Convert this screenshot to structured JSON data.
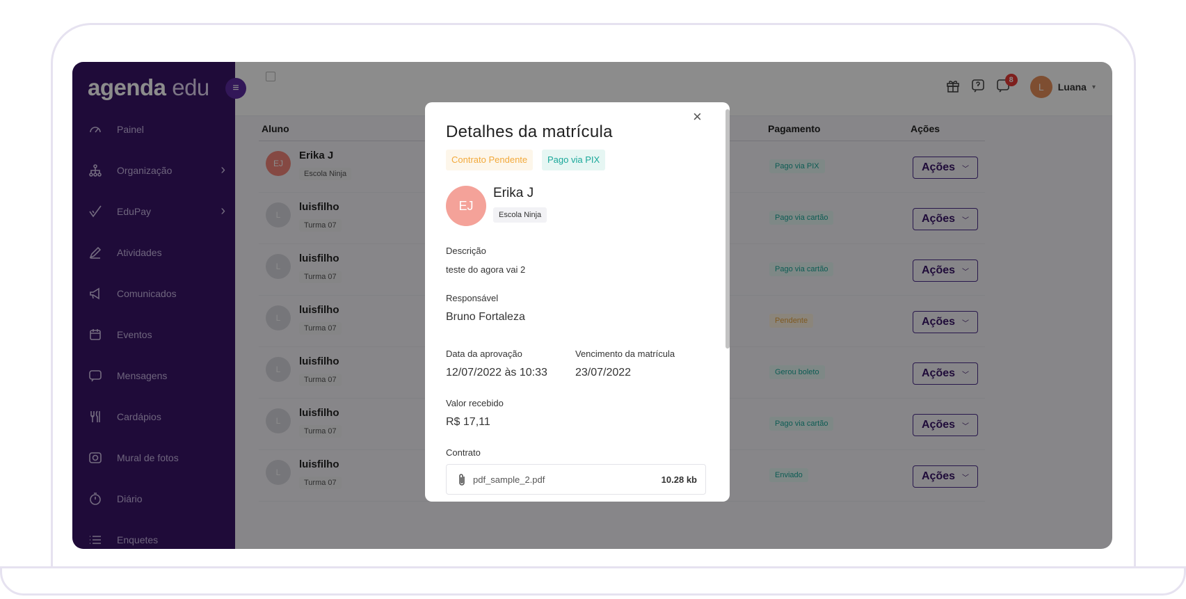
{
  "brand": {
    "logo_bold": "agenda",
    "logo_light": "edu",
    "collapse_glyph": "≡"
  },
  "sidebar": {
    "items": [
      {
        "label": "Painel",
        "icon": "gauge-icon"
      },
      {
        "label": "Organização",
        "icon": "org-chart-icon",
        "has_submenu": true
      },
      {
        "label": "EduPay",
        "icon": "edupay-check-icon",
        "has_submenu": true
      },
      {
        "label": "Atividades",
        "icon": "pencil-icon"
      },
      {
        "label": "Comunicados",
        "icon": "megaphone-icon"
      },
      {
        "label": "Eventos",
        "icon": "calendar-icon"
      },
      {
        "label": "Mensagens",
        "icon": "chat-icon"
      },
      {
        "label": "Cardápios",
        "icon": "utensils-icon"
      },
      {
        "label": "Mural de fotos",
        "icon": "camera-icon"
      },
      {
        "label": "Diário",
        "icon": "stopwatch-icon"
      },
      {
        "label": "Enquetes",
        "icon": "list-icon"
      }
    ]
  },
  "topbar": {
    "notifications_count": "8",
    "user_initial": "L",
    "user_name": "Luana",
    "caret": "▾"
  },
  "table": {
    "headers": {
      "aluno": "Aluno",
      "pagamento": "Pagamento",
      "acoes": "Ações"
    },
    "action_label": "Ações",
    "action_chevron": "﹀",
    "rows": [
      {
        "initials": "EJ",
        "name": "Erika J",
        "class": "Escola Ninja",
        "status": "Pago via PIX",
        "status_color": "green"
      },
      {
        "initials": "L",
        "name": "luisfilho",
        "class": "Turma 07",
        "status": "Pago via cartão",
        "status_color": "green"
      },
      {
        "initials": "L",
        "name": "luisfilho",
        "class": "Turma 07",
        "status": "Pago via cartão",
        "status_color": "green"
      },
      {
        "initials": "L",
        "name": "luisfilho",
        "class": "Turma 07",
        "status": "Pendente",
        "status_color": "yellow"
      },
      {
        "initials": "L",
        "name": "luisfilho",
        "class": "Turma 07",
        "status": "Gerou boleto",
        "status_color": "green"
      },
      {
        "initials": "L",
        "name": "luisfilho",
        "class": "Turma 07",
        "status": "Pago via cartão",
        "status_color": "green"
      },
      {
        "initials": "L",
        "name": "luisfilho",
        "class": "Turma 07",
        "status": "Enviado",
        "status_color": "green"
      }
    ]
  },
  "modal": {
    "close_glyph": "×",
    "title": "Detalhes da matrícula",
    "tag_contract": "Contrato Pendente",
    "tag_payment": "Pago via PIX",
    "student_initials": "EJ",
    "student_name": "Erika J",
    "student_school": "Escola Ninja",
    "descricao_label": "Descrição",
    "descricao_value": "teste do agora vai 2",
    "responsavel_label": "Responsável",
    "responsavel_value": "Bruno Fortaleza",
    "aprovacao_label": "Data da aprovação",
    "aprovacao_value": "12/07/2022 às 10:33",
    "vencimento_label": "Vencimento da matrícula",
    "vencimento_value": "23/07/2022",
    "valor_label": "Valor recebido",
    "valor_value": "R$ 17,11",
    "contrato_label": "Contrato",
    "file_name": "pdf_sample_2.pdf",
    "file_size": "10.28 kb"
  },
  "colors": {
    "sidebar_bg": "#3a1569",
    "accent": "#5b2aa0",
    "status_green": "#1aa89a",
    "status_yellow": "#f2a93b",
    "badge_red": "#e53935",
    "avatar_ej": "#f4a299"
  }
}
